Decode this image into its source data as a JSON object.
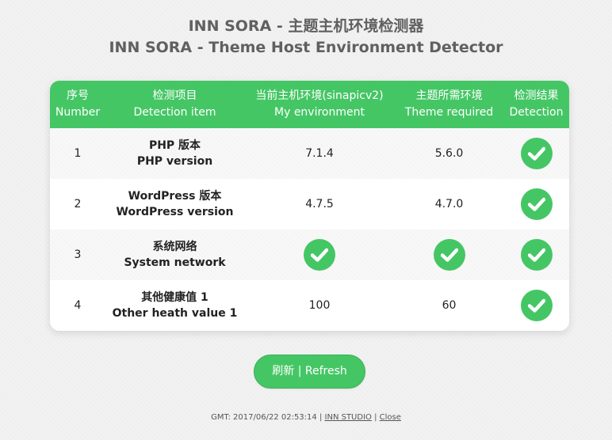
{
  "header": {
    "title_zh": "INN SORA - 主题主机环境检测器",
    "title_en": "INN SORA - Theme Host Environment Detector"
  },
  "table": {
    "columns": [
      {
        "zh": "序号",
        "en": "Number"
      },
      {
        "zh": "检测项目",
        "en": "Detection item"
      },
      {
        "zh": "当前主机环境(sinapicv2)",
        "en": "My environment"
      },
      {
        "zh": "主题所需环境",
        "en": "Theme required"
      },
      {
        "zh": "检测结果",
        "en": "Detection"
      }
    ],
    "rows": [
      {
        "number": "1",
        "item_zh": "PHP 版本",
        "item_en": "PHP version",
        "current": "7.1.4",
        "required": "5.6.0",
        "result": "check-icon"
      },
      {
        "number": "2",
        "item_zh": "WordPress 版本",
        "item_en": "WordPress version",
        "current": "4.7.5",
        "required": "4.7.0",
        "result": "check-icon"
      },
      {
        "number": "3",
        "item_zh": "系统网络",
        "item_en": "System network",
        "current": "check-icon",
        "required": "check-icon",
        "result": "check-icon"
      },
      {
        "number": "4",
        "item_zh": "其他健康值 1",
        "item_en": "Other heath value 1",
        "current": "100",
        "required": "60",
        "result": "check-icon"
      }
    ]
  },
  "refresh_label": "刷新 | Refresh",
  "footer": {
    "gmt": "GMT: 2017/06/22 02:53:14",
    "separator": "|",
    "studio_link": "INN STUDIO",
    "close_link": "Close"
  },
  "colors": {
    "accent": "#45c665",
    "title": "#606060",
    "background": "#efefef"
  }
}
